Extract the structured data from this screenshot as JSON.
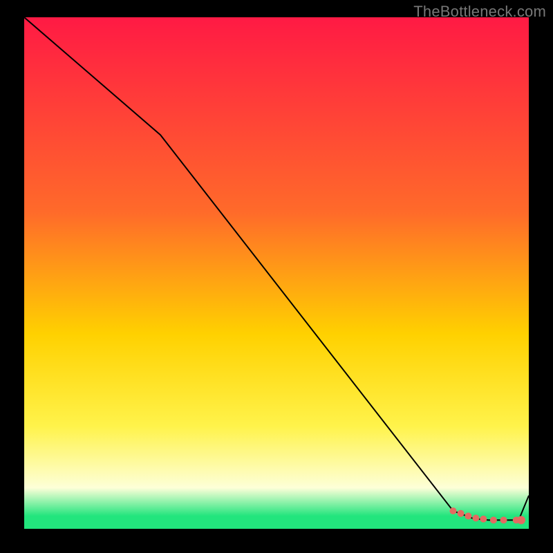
{
  "watermark": "TheBottleneck.com",
  "colors": {
    "frame": "#000000",
    "watermark": "#777777",
    "gradient_top": "#ff1a44",
    "gradient_mid_upper": "#ff6a2a",
    "gradient_mid": "#ffd100",
    "gradient_mid_lower": "#fff34b",
    "gradient_pale": "#fdffd8",
    "gradient_green": "#22e57d",
    "line": "#000000",
    "marker": "#e46a61"
  },
  "chart_data": {
    "type": "line",
    "title": "",
    "xlabel": "",
    "ylabel": "",
    "x_range": [
      0,
      100
    ],
    "y_range": [
      0,
      100
    ],
    "series": [
      {
        "name": "curve",
        "x": [
          0,
          27,
          85,
          89,
          92,
          95,
          98,
          100
        ],
        "y": [
          100,
          77,
          3.5,
          2.0,
          1.7,
          1.7,
          1.7,
          6.5
        ]
      }
    ],
    "markers": {
      "name": "highlight-points",
      "x": [
        85,
        86.5,
        88,
        89.5,
        91,
        93,
        95,
        97.5,
        98.5
      ],
      "y": [
        3.5,
        3.0,
        2.5,
        2.1,
        1.9,
        1.7,
        1.7,
        1.7,
        1.7
      ]
    },
    "gradient_stops_pct": {
      "red": 0,
      "orange": 38,
      "yellow": 62,
      "bright_yellow": 80,
      "pale": 92,
      "green_start": 97.5,
      "green_end": 100
    }
  }
}
